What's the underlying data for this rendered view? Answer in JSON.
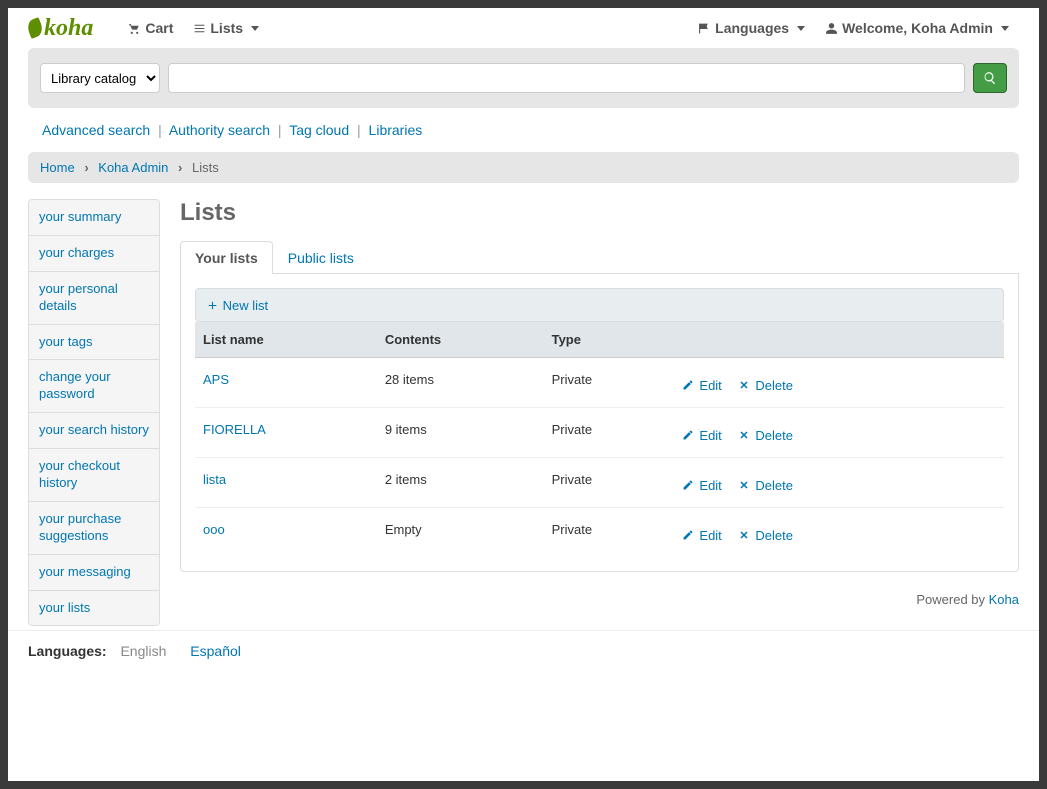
{
  "topnav": {
    "logo": "koha",
    "cart": "Cart",
    "lists": "Lists",
    "languages": "Languages",
    "welcome": "Welcome, Koha Admin"
  },
  "search": {
    "scope": "Library catalog",
    "query": ""
  },
  "sublinks": {
    "advanced": "Advanced search",
    "authority": "Authority search",
    "tagcloud": "Tag cloud",
    "libraries": "Libraries"
  },
  "breadcrumb": {
    "home": "Home",
    "user": "Koha Admin",
    "current": "Lists"
  },
  "sidebar": {
    "items": [
      "your summary",
      "your charges",
      "your personal details",
      "your tags",
      "change your password",
      "your search history",
      "your checkout history",
      "your purchase suggestions",
      "your messaging",
      "your lists"
    ]
  },
  "main": {
    "title": "Lists",
    "tabs": {
      "your": "Your lists",
      "public": "Public lists"
    },
    "toolbar": {
      "newlist": "New list"
    },
    "headers": {
      "name": "List name",
      "contents": "Contents",
      "type": "Type"
    },
    "actions": {
      "edit": "Edit",
      "delete": "Delete"
    },
    "rows": [
      {
        "name": "APS",
        "contents": "28 items",
        "type": "Private"
      },
      {
        "name": "FIORELLA",
        "contents": "9 items",
        "type": "Private"
      },
      {
        "name": "lista",
        "contents": "2 items",
        "type": "Private"
      },
      {
        "name": "ooo",
        "contents": "Empty",
        "type": "Private"
      }
    ]
  },
  "footer": {
    "powered": "Powered by ",
    "koha": "Koha",
    "languages_label": "Languages:",
    "current_lang": "English",
    "other_lang": "Español"
  }
}
